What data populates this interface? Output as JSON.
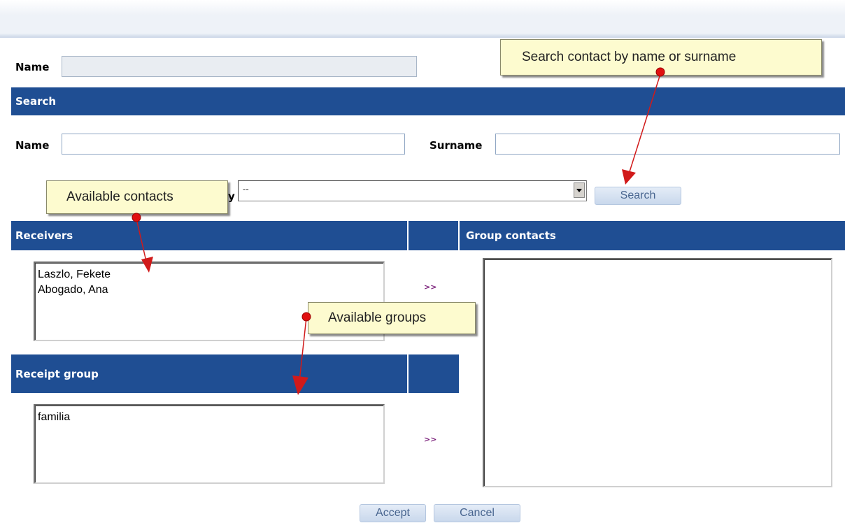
{
  "form": {
    "name_label": "Name",
    "name_value": ""
  },
  "search": {
    "header": "Search",
    "name_label": "Name",
    "name_value": "",
    "surname_label": "Surname",
    "surname_value": "",
    "partial_label": "y",
    "select_value": "--",
    "button_label": "Search"
  },
  "receivers": {
    "header": "Receivers",
    "items": [
      "Laszlo, Fekete",
      "Abogado, Ana"
    ],
    "move_label": ">>"
  },
  "receipt_group": {
    "header": "Receipt group",
    "items": [
      "familia"
    ],
    "move_label": ">>"
  },
  "group_contacts": {
    "header": "Group contacts",
    "items": []
  },
  "actions": {
    "accept_label": "Accept",
    "cancel_label": "Cancel"
  },
  "callouts": {
    "search_contact": "Search contact by name or surname",
    "available_contacts": "Available contacts",
    "available_groups": "Available groups"
  },
  "colors": {
    "header_bar": "#1f4e93",
    "callout_bg": "#fdfbcf",
    "arrow": "#d11a1a",
    "button_text": "#48658f"
  }
}
